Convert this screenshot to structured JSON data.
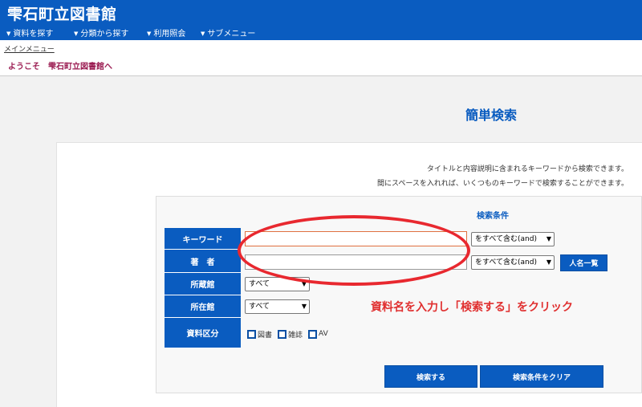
{
  "header": {
    "site_title": "雫石町立図書館",
    "nav": [
      {
        "label": "資料を探す"
      },
      {
        "label": "分類から探す"
      },
      {
        "label": "利用照会"
      },
      {
        "label": "サブメニュー"
      }
    ]
  },
  "subbar": {
    "menu_link": "メインメニュー",
    "welcome": "ようこそ　雫石町立図書館へ"
  },
  "page": {
    "title": "簡単検索",
    "desc_line1": "タイトルと内容説明に含まれるキーワードから検索できます。",
    "desc_line2": "間にスペースを入れれば、いくつものキーワードで検索することができます。"
  },
  "form": {
    "section_title": "検索条件",
    "keyword_label": "キーワード",
    "keyword_value": "",
    "keyword_mode": "をすべて含む(and)",
    "author_label": "著　者",
    "author_value": "",
    "author_mode": "をすべて含む(and)",
    "author_list_button": "人名一覧",
    "holding_label": "所蔵館",
    "holding_value": "すべて",
    "location_label": "所在館",
    "location_value": "すべて",
    "material_label": "資料区分",
    "material_options": [
      {
        "label": "図書",
        "checked": false
      },
      {
        "label": "雑誌",
        "checked": false
      },
      {
        "label": "AV",
        "checked": false
      }
    ],
    "search_button": "検索する",
    "clear_button": "検索条件をクリア"
  },
  "annotation": {
    "text": "資料名を入力し「検索する」をクリック",
    "color": "#e03030"
  },
  "colors": {
    "brand": "#0a5cc0",
    "welcome": "#9b1c52"
  }
}
